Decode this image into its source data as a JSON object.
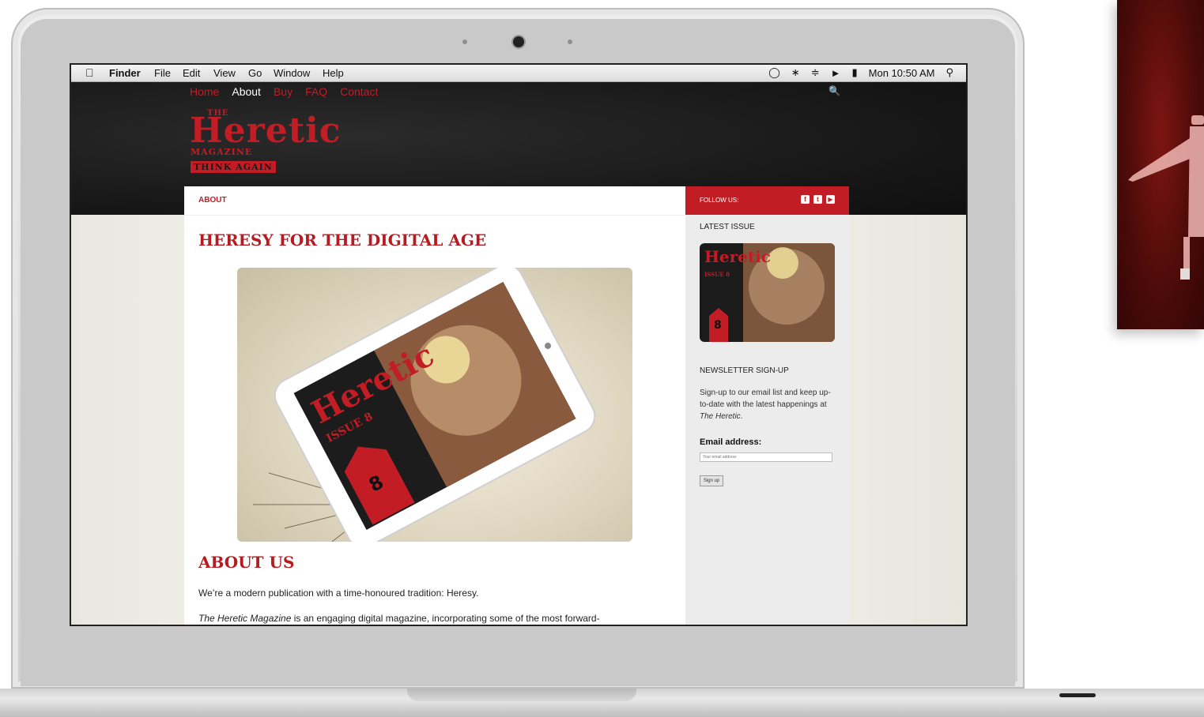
{
  "menubar": {
    "items": [
      "Finder",
      "File",
      "Edit",
      "View",
      "Go",
      "Window",
      "Help"
    ],
    "clock": "Mon 10:50 AM",
    "status_icons": [
      "notifications-icon",
      "bluetooth-icon",
      "wifi-icon",
      "volume-icon",
      "battery-icon",
      "spotlight-icon"
    ]
  },
  "site": {
    "nav": [
      "Home",
      "About",
      "Buy",
      "FAQ",
      "Contact"
    ],
    "active_nav": "About",
    "logo": {
      "the": "THE",
      "name": "Heretic",
      "magazine": "MAGAZINE",
      "tagline": "THINK AGAIN"
    },
    "breadcrumb": "ABOUT",
    "heading": "HERESY FOR THE DIGITAL AGE",
    "hero_issue": {
      "name": "Heretic",
      "issue": "ISSUE 8",
      "number": "8"
    },
    "about_heading": "ABOUT US",
    "paragraph1": "We’re a modern publication with a time-honoured tradition: Heresy.",
    "paragraph2_em": "The Heretic Magazine",
    "paragraph2_rest": " is an engaging digital magazine, incorporating some of the most forward-",
    "sidebar": {
      "follow_label": "FOLLOW US:",
      "social_icons": [
        "facebook-icon",
        "twitter-icon",
        "youtube-icon"
      ],
      "latest_issue_heading": "LATEST ISSUE",
      "cover": {
        "name": "Heretic",
        "issue": "ISSUE 8",
        "number": "8"
      },
      "newsletter_heading": "NEWSLETTER SIGN-UP",
      "newsletter_text": "Sign-up to our email list and keep up-to-date with the latest happenings at ",
      "newsletter_em": "The Heretic",
      "newsletter_end": ".",
      "email_label": "Email address:",
      "email_placeholder": "Your email address",
      "signup_button": "Sign up"
    }
  },
  "colors": {
    "brand_red": "#c21d24",
    "header_dark": "#161616"
  }
}
